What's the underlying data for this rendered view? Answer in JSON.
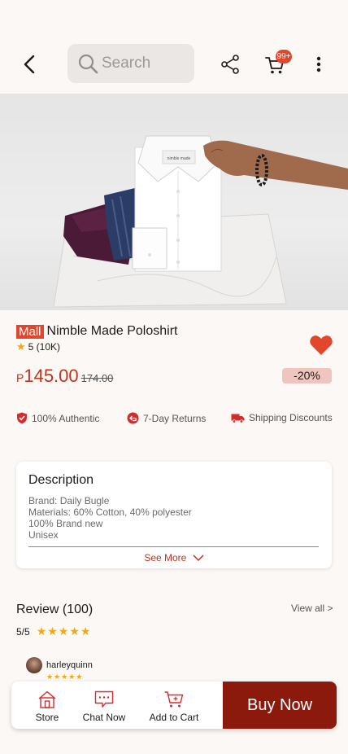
{
  "header": {
    "search_placeholder": "Search",
    "cart_badge": "99+",
    "icons": [
      "back-arrow-icon",
      "search-icon",
      "share-icon",
      "cart-icon",
      "more-vertical-icon"
    ]
  },
  "product": {
    "mall_badge": "Mall",
    "name": "Nimble Made Poloshirt",
    "rating": "5 (10K)",
    "currency": "P",
    "price": "145.00",
    "old_price": "174.00",
    "discount": "-20%",
    "favorited": true
  },
  "assurances": [
    {
      "label": "100% Authentic",
      "icon": "shield-check-icon"
    },
    {
      "label": "7-Day Returns",
      "icon": "return-icon"
    },
    {
      "label": "Shipping Discounts",
      "icon": "truck-icon"
    }
  ],
  "description": {
    "title": "Description",
    "lines": [
      "Brand: Daily Bugle",
      "Materials: 60% Cotton, 40% polyester",
      "100% Brand new",
      "Unisex"
    ],
    "see_more": "See More"
  },
  "reviews": {
    "title": "Review (100)",
    "view_all": "View all >",
    "score": "5/5",
    "first_reviewer": "harleyquinn"
  },
  "bottom_bar": {
    "store": "Store",
    "chat": "Chat Now",
    "add_to_cart": "Add to Cart",
    "buy_now": "Buy Now"
  },
  "colors": {
    "accent": "#e2472e",
    "price": "#c0341d",
    "buy_now": "#8b1a0c",
    "star": "#f3a712"
  }
}
